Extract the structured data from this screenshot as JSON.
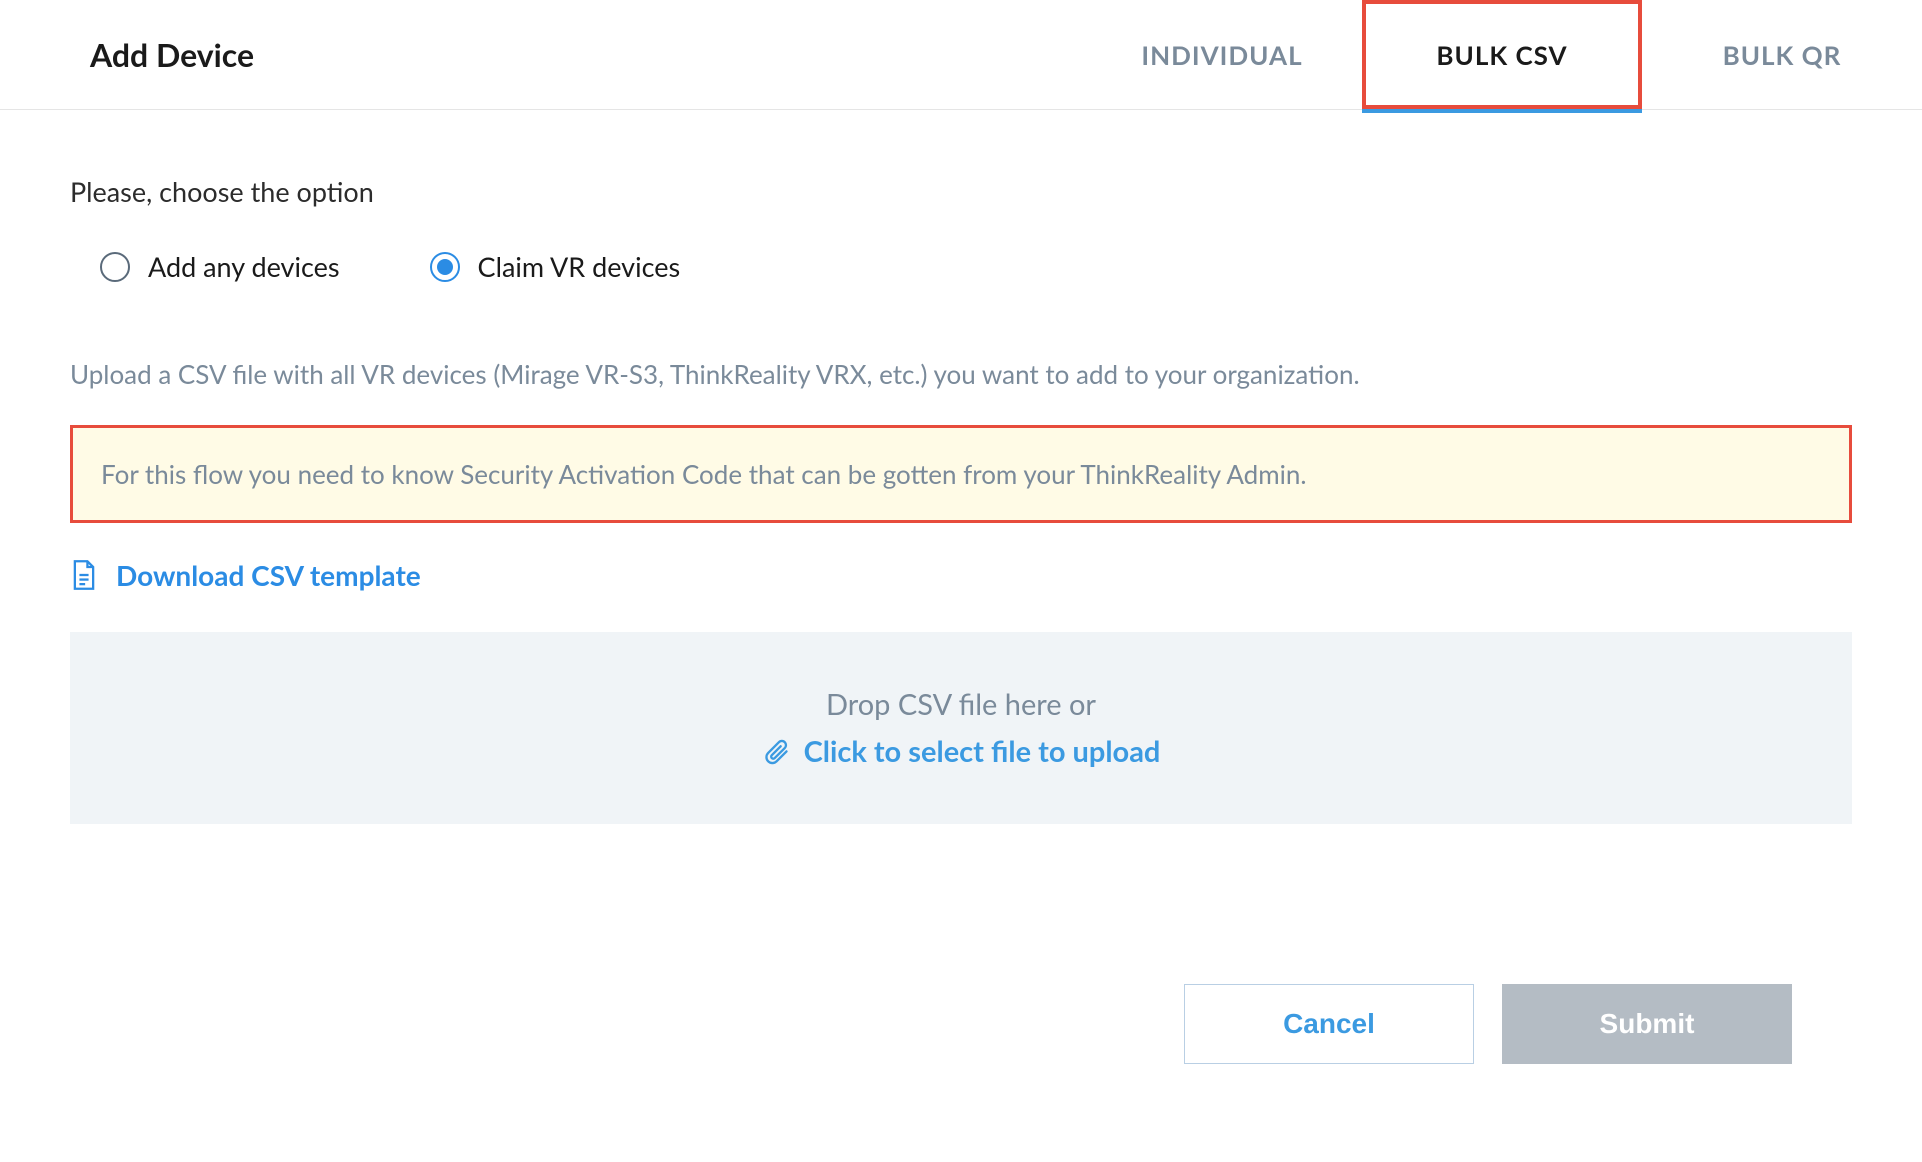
{
  "header": {
    "title": "Add Device",
    "tabs": [
      {
        "label": "INDIVIDUAL",
        "active": false
      },
      {
        "label": "BULK CSV",
        "active": true
      },
      {
        "label": "BULK QR",
        "active": false
      }
    ]
  },
  "prompt": "Please, choose the option",
  "radios": [
    {
      "label": "Add any devices",
      "selected": false
    },
    {
      "label": "Claim VR devices",
      "selected": true
    }
  ],
  "description": "Upload a CSV file with all VR devices (Mirage VR-S3, ThinkReality VRX, etc.) you want to add to your organization.",
  "info_banner": "For this flow you need to know Security Activation Code that can be gotten from your ThinkReality Admin.",
  "download_link": "Download CSV template",
  "dropzone": {
    "text": "Drop CSV file here or",
    "link": "Click to select file to upload"
  },
  "buttons": {
    "cancel": "Cancel",
    "submit": "Submit"
  }
}
